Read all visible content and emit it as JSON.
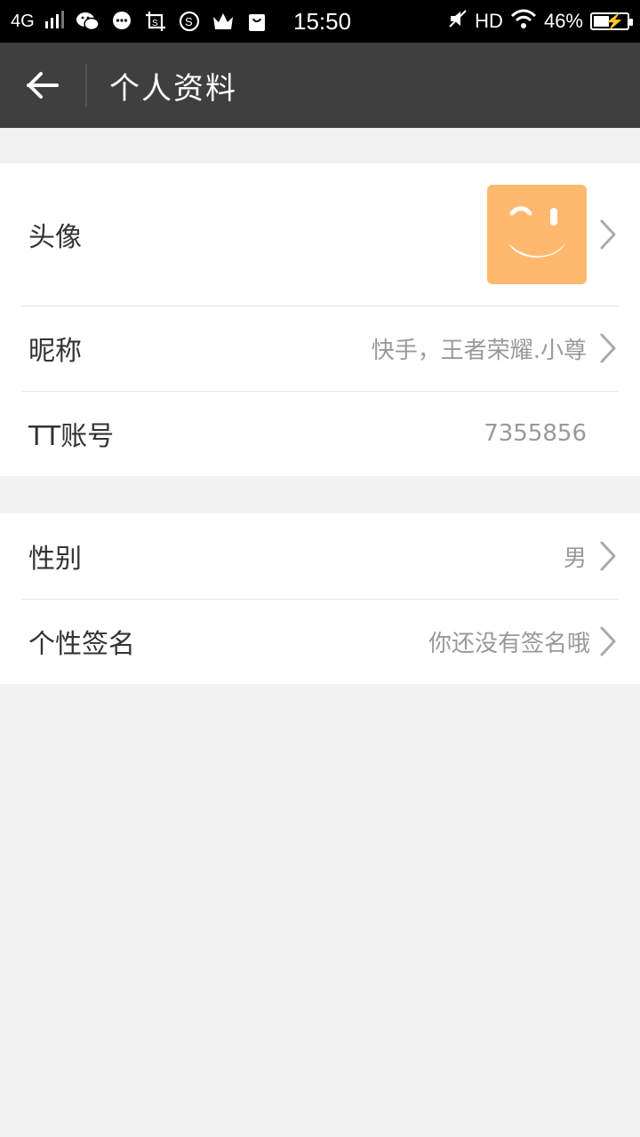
{
  "status_bar": {
    "network": "4G",
    "time": "15:50",
    "hd": "HD",
    "battery": "46%",
    "battery_level": 0.46,
    "icons": [
      "wechat-icon",
      "message-icon",
      "screenshot-icon",
      "sogou-icon",
      "crown-icon",
      "shopping-bag-icon"
    ]
  },
  "app_bar": {
    "title": "个人资料",
    "back_icon": "back-arrow-icon"
  },
  "profile": {
    "avatar_label": "头像",
    "nickname_label": "昵称",
    "nickname_value": "快手，王者荣耀.小尊",
    "account_label": "TT账号",
    "account_value": "7355856"
  },
  "details": {
    "gender_label": "性别",
    "gender_value": "男",
    "signature_label": "个性签名",
    "signature_value": "你还没有签名哦"
  },
  "colors": {
    "app_bar": "#3f3f3f",
    "avatar_bg": "#ffb96e",
    "background": "#f2f2f2"
  }
}
